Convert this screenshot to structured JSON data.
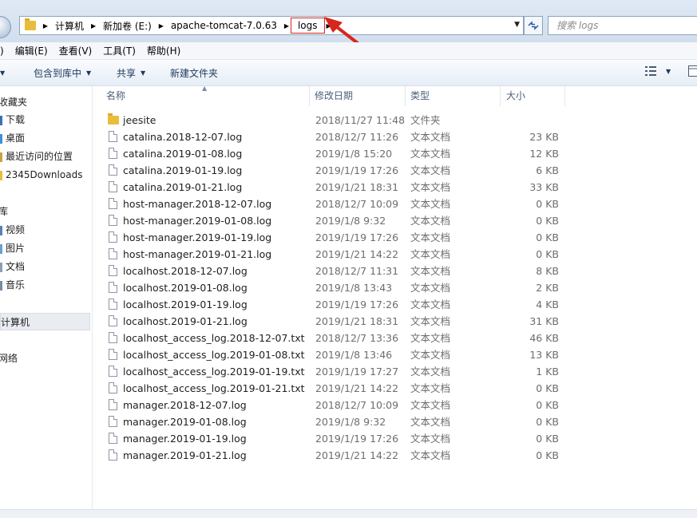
{
  "address": {
    "crumbs": [
      "计算机",
      "新加卷 (E:)",
      "apache-tomcat-7.0.63",
      "logs"
    ],
    "search_placeholder": "搜索 logs"
  },
  "menu": [
    "编辑(E)",
    "查看(V)",
    "工具(T)",
    "帮助(H)"
  ],
  "menu_lead": ")",
  "toolbar": {
    "include_library": "包含到库中",
    "share": "共享",
    "new_folder": "新建文件夹"
  },
  "sidebar": {
    "favorites": "收藏夹",
    "fav_items": [
      "下载",
      "桌面",
      "最近访问的位置",
      "2345Downloads"
    ],
    "libraries": "库",
    "lib_items": [
      "视频",
      "图片",
      "文档",
      "音乐"
    ],
    "computer": "计算机",
    "network": "网络"
  },
  "columns": {
    "name": "名称",
    "date": "修改日期",
    "type": "类型",
    "size": "大小"
  },
  "files": [
    {
      "name": "jeesite",
      "date": "2018/11/27 11:48",
      "type": "文件夹",
      "size": "",
      "kind": "folder"
    },
    {
      "name": "catalina.2018-12-07.log",
      "date": "2018/12/7 11:26",
      "type": "文本文档",
      "size": "23 KB",
      "kind": "file"
    },
    {
      "name": "catalina.2019-01-08.log",
      "date": "2019/1/8 15:20",
      "type": "文本文档",
      "size": "12 KB",
      "kind": "file"
    },
    {
      "name": "catalina.2019-01-19.log",
      "date": "2019/1/19 17:26",
      "type": "文本文档",
      "size": "6 KB",
      "kind": "file"
    },
    {
      "name": "catalina.2019-01-21.log",
      "date": "2019/1/21 18:31",
      "type": "文本文档",
      "size": "33 KB",
      "kind": "file"
    },
    {
      "name": "host-manager.2018-12-07.log",
      "date": "2018/12/7 10:09",
      "type": "文本文档",
      "size": "0 KB",
      "kind": "file"
    },
    {
      "name": "host-manager.2019-01-08.log",
      "date": "2019/1/8 9:32",
      "type": "文本文档",
      "size": "0 KB",
      "kind": "file"
    },
    {
      "name": "host-manager.2019-01-19.log",
      "date": "2019/1/19 17:26",
      "type": "文本文档",
      "size": "0 KB",
      "kind": "file"
    },
    {
      "name": "host-manager.2019-01-21.log",
      "date": "2019/1/21 14:22",
      "type": "文本文档",
      "size": "0 KB",
      "kind": "file"
    },
    {
      "name": "localhost.2018-12-07.log",
      "date": "2018/12/7 11:31",
      "type": "文本文档",
      "size": "8 KB",
      "kind": "file"
    },
    {
      "name": "localhost.2019-01-08.log",
      "date": "2019/1/8 13:43",
      "type": "文本文档",
      "size": "2 KB",
      "kind": "file"
    },
    {
      "name": "localhost.2019-01-19.log",
      "date": "2019/1/19 17:26",
      "type": "文本文档",
      "size": "4 KB",
      "kind": "file"
    },
    {
      "name": "localhost.2019-01-21.log",
      "date": "2019/1/21 18:31",
      "type": "文本文档",
      "size": "31 KB",
      "kind": "file"
    },
    {
      "name": "localhost_access_log.2018-12-07.txt",
      "date": "2018/12/7 13:36",
      "type": "文本文档",
      "size": "46 KB",
      "kind": "file"
    },
    {
      "name": "localhost_access_log.2019-01-08.txt",
      "date": "2019/1/8 13:46",
      "type": "文本文档",
      "size": "13 KB",
      "kind": "file"
    },
    {
      "name": "localhost_access_log.2019-01-19.txt",
      "date": "2019/1/19 17:27",
      "type": "文本文档",
      "size": "1 KB",
      "kind": "file"
    },
    {
      "name": "localhost_access_log.2019-01-21.txt",
      "date": "2019/1/21 14:22",
      "type": "文本文档",
      "size": "0 KB",
      "kind": "file"
    },
    {
      "name": "manager.2018-12-07.log",
      "date": "2018/12/7 10:09",
      "type": "文本文档",
      "size": "0 KB",
      "kind": "file"
    },
    {
      "name": "manager.2019-01-08.log",
      "date": "2019/1/8 9:32",
      "type": "文本文档",
      "size": "0 KB",
      "kind": "file"
    },
    {
      "name": "manager.2019-01-19.log",
      "date": "2019/1/19 17:26",
      "type": "文本文档",
      "size": "0 KB",
      "kind": "file"
    },
    {
      "name": "manager.2019-01-21.log",
      "date": "2019/1/21 14:22",
      "type": "文本文档",
      "size": "0 KB",
      "kind": "file"
    }
  ],
  "colors": {
    "annotation_red": "#d8261c",
    "folder_yellow": "#e9bd3c",
    "secondary_text": "#6d6d6d"
  }
}
